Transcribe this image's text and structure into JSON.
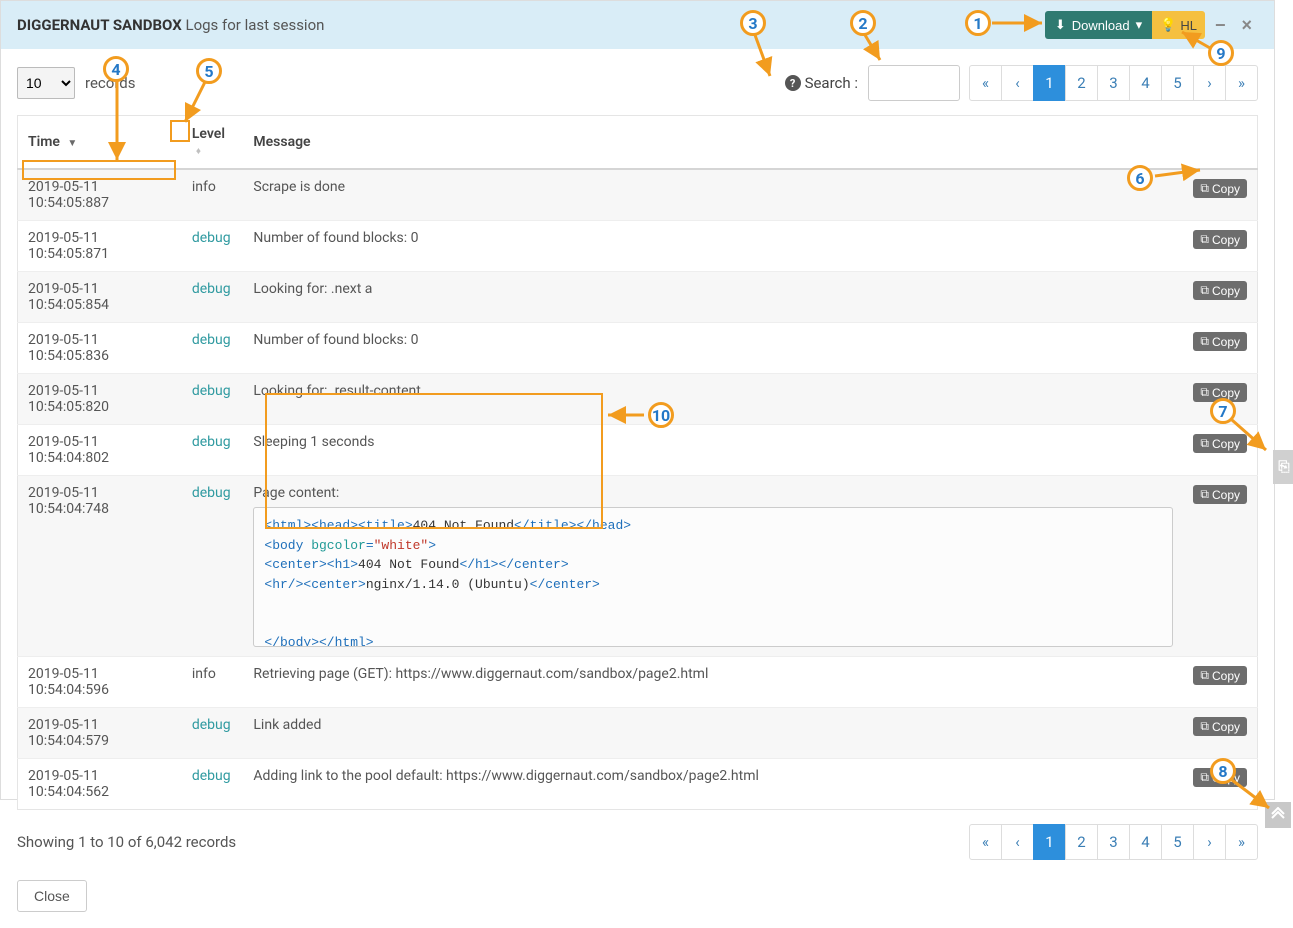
{
  "header": {
    "title_bold": "DIGGERNAUT SANDBOX",
    "title_sub": "Logs for last session",
    "download_label": "Download",
    "hl_label": "HL"
  },
  "controls": {
    "records_value": "10",
    "records_label": "records",
    "search_label": "Search :",
    "search_value": ""
  },
  "pagination": {
    "first": "«",
    "prev": "‹",
    "pages": [
      "1",
      "2",
      "3",
      "4",
      "5"
    ],
    "active_page": "1",
    "next": "›",
    "last": "»"
  },
  "columns": {
    "time": "Time",
    "level": "Level",
    "message": "Message"
  },
  "copy_label": "Copy",
  "rows": [
    {
      "time": "2019-05-11 10:54:05:887",
      "level": "info",
      "message": "Scrape is done"
    },
    {
      "time": "2019-05-11 10:54:05:871",
      "level": "debug",
      "message": "Number of found blocks: 0"
    },
    {
      "time": "2019-05-11 10:54:05:854",
      "level": "debug",
      "message": "Looking for: .next a"
    },
    {
      "time": "2019-05-11 10:54:05:836",
      "level": "debug",
      "message": "Number of found blocks: 0"
    },
    {
      "time": "2019-05-11 10:54:05:820",
      "level": "debug",
      "message": "Looking for: .result-content"
    },
    {
      "time": "2019-05-11 10:54:04:802",
      "level": "debug",
      "message": "Sleeping 1 seconds"
    },
    {
      "time": "2019-05-11 10:54:04:748",
      "level": "debug",
      "message": "Page content:"
    },
    {
      "time": "2019-05-11 10:54:04:596",
      "level": "info",
      "message": "Retrieving page (GET): https://www.diggernaut.com/sandbox/page2.html"
    },
    {
      "time": "2019-05-11 10:54:04:579",
      "level": "debug",
      "message": "Link added"
    },
    {
      "time": "2019-05-11 10:54:04:562",
      "level": "debug",
      "message": "Adding link to the pool default: https://www.diggernaut.com/sandbox/page2.html"
    }
  ],
  "code": {
    "l1a": "<html><head><title>",
    "l1b": "404 Not Found",
    "l1c": "</title></head>",
    "l2a": "<body ",
    "l2b": "bgcolor",
    "l2c": "=",
    "l2d": "\"white\"",
    "l2e": ">",
    "l3a": "<center><h1>",
    "l3b": "404 Not Found",
    "l3c": "</h1></center>",
    "l4a": "<hr/><center>",
    "l4b": "nginx/1.14.0 (Ubuntu)",
    "l4c": "</center>",
    "l5a": "</body></html>"
  },
  "showing": "Showing 1 to 10 of 6,042 records",
  "close_label": "Close",
  "annotations": {
    "b1": "1",
    "b2": "2",
    "b3": "3",
    "b4": "4",
    "b5": "5",
    "b6": "6",
    "b7": "7",
    "b8": "8",
    "b9": "9",
    "b10": "10"
  }
}
